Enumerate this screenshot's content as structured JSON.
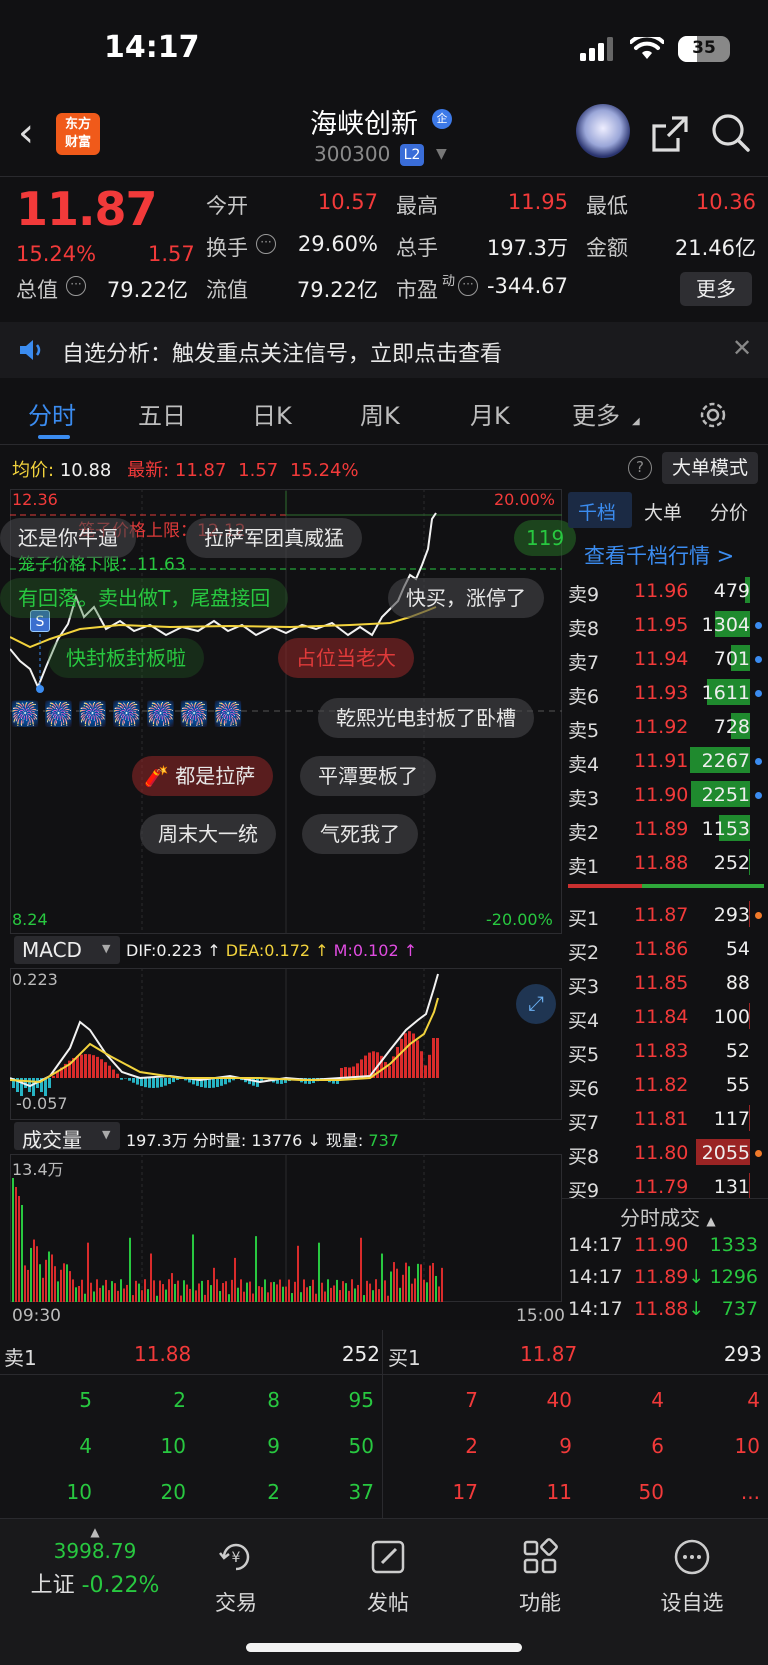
{
  "status": {
    "time": "14:17",
    "battery": "35"
  },
  "header": {
    "logo_line1": "东方",
    "logo_line2": "财富",
    "stock_name": "海峡创新",
    "stock_badge": "企",
    "stock_code": "300300",
    "level_badge": "L2"
  },
  "quote": {
    "price": "11.87",
    "pct": "15.24%",
    "change": "1.57",
    "open_label": "今开",
    "open": "10.57",
    "high_label": "最高",
    "high": "11.95",
    "low_label": "最低",
    "low": "10.36",
    "turnover_label": "换手",
    "turnover": "29.60%",
    "volume_label": "总手",
    "volume": "197.3万",
    "amount_label": "金额",
    "amount": "21.46亿",
    "mktcap_label": "总值",
    "mktcap": "79.22亿",
    "float_label": "流值",
    "float": "79.22亿",
    "pe_label": "市盈",
    "pe_sup": "动",
    "pe": "-344.67",
    "more_button": "更多"
  },
  "notice": {
    "text": "自选分析：触发重点关注信号，立即点击查看"
  },
  "tabs": [
    "分时",
    "五日",
    "日K",
    "周K",
    "月K",
    "更多"
  ],
  "chart_header": {
    "avg_label": "均价:",
    "avg_value": "10.88",
    "latest_label": "最新:",
    "latest_value": "11.87",
    "latest_change": "1.57",
    "latest_pct": "15.24%",
    "big_order_button": "大单模式"
  },
  "chart_labels": {
    "top_price": "12.36",
    "top_pct": "20.00%",
    "bottom_price": "8.24",
    "bottom_pct": "-20.00%",
    "cage_upper": "笼子价格上限：12.12",
    "cage_lower": "笼子价格下限：11.63",
    "sell_marker": "S",
    "right_edge_value": "119",
    "time_start": "09:30",
    "time_end": "15:00"
  },
  "bubbles": [
    "还是你牛逼",
    "拉萨军团真威猛",
    "有回落。卖出做T，尾盘接回",
    "快买，涨停了",
    "快封板封板啦",
    "占位当老大",
    "乾熙光电封板了卧槽",
    "都是拉萨",
    "平潭要板了",
    "周末大一统",
    "气死我了"
  ],
  "macd": {
    "label": "MACD",
    "dif": "DIF:0.223",
    "dea": "DEA:0.172",
    "m": "M:0.102",
    "top": "0.223",
    "bottom": "-0.057"
  },
  "volume_panel": {
    "label": "成交量",
    "total": "197.3万",
    "minute_label": "分时量:",
    "minute": "13776",
    "current_label": "现量:",
    "current": "737",
    "max": "13.4万"
  },
  "orderbook": {
    "tabs": [
      "千档",
      "大单",
      "分价"
    ],
    "view_depth": "查看千档行情 >",
    "asks": [
      {
        "label": "卖9",
        "price": "11.96",
        "vol": "479",
        "bar": 0.09,
        "dot": ""
      },
      {
        "label": "卖8",
        "price": "11.95",
        "vol": "1304",
        "bar": 0.58,
        "dot": "#3b8cf0"
      },
      {
        "label": "卖7",
        "price": "11.94",
        "vol": "701",
        "bar": 0.31,
        "dot": "#3b8cf0"
      },
      {
        "label": "卖6",
        "price": "11.93",
        "vol": "1611",
        "bar": 0.72,
        "dot": "#3b8cf0"
      },
      {
        "label": "卖5",
        "price": "11.92",
        "vol": "728",
        "bar": 0.32,
        "dot": ""
      },
      {
        "label": "卖4",
        "price": "11.91",
        "vol": "2267",
        "bar": 1.0,
        "dot": "#3b8cf0"
      },
      {
        "label": "卖3",
        "price": "11.90",
        "vol": "2251",
        "bar": 0.99,
        "dot": "#3b8cf0"
      },
      {
        "label": "卖2",
        "price": "11.89",
        "vol": "1153",
        "bar": 0.51,
        "dot": ""
      },
      {
        "label": "卖1",
        "price": "11.88",
        "vol": "252",
        "bar": 0.02,
        "dot": ""
      }
    ],
    "bids": [
      {
        "label": "买1",
        "price": "11.87",
        "vol": "293",
        "bar": 0.02,
        "dot": "#f07a2a"
      },
      {
        "label": "买2",
        "price": "11.86",
        "vol": "54",
        "bar": 0.0,
        "dot": ""
      },
      {
        "label": "买3",
        "price": "11.85",
        "vol": "88",
        "bar": 0.0,
        "dot": ""
      },
      {
        "label": "买4",
        "price": "11.84",
        "vol": "100",
        "bar": 0.02,
        "dot": ""
      },
      {
        "label": "买5",
        "price": "11.83",
        "vol": "52",
        "bar": 0.0,
        "dot": ""
      },
      {
        "label": "买6",
        "price": "11.82",
        "vol": "55",
        "bar": 0.0,
        "dot": ""
      },
      {
        "label": "买7",
        "price": "11.81",
        "vol": "117",
        "bar": 0.02,
        "dot": ""
      },
      {
        "label": "买8",
        "price": "11.80",
        "vol": "2055",
        "bar": 0.9,
        "dot": "#f07a2a"
      },
      {
        "label": "买9",
        "price": "11.79",
        "vol": "131",
        "bar": 0.02,
        "dot": ""
      }
    ],
    "ticks_title": "分时成交",
    "ticks": [
      {
        "time": "14:17",
        "price": "11.90",
        "arrow": "",
        "vol": "1333",
        "price_color": "#f23a3a"
      },
      {
        "time": "14:17",
        "price": "11.89",
        "arrow": "↓",
        "vol": "1296",
        "price_color": "#f23a3a"
      },
      {
        "time": "14:17",
        "price": "11.88",
        "arrow": "↓",
        "vol": "737",
        "price_color": "#f23a3a"
      }
    ]
  },
  "bottom_queue": {
    "sell_label": "卖1",
    "sell_price": "11.88",
    "sell_vol": "252",
    "buy_label": "买1",
    "buy_price": "11.87",
    "buy_vol": "293",
    "sell_rows": [
      [
        "5",
        "2",
        "8",
        "95"
      ],
      [
        "4",
        "10",
        "9",
        "50"
      ],
      [
        "10",
        "20",
        "2",
        "37"
      ]
    ],
    "buy_rows": [
      [
        "7",
        "40",
        "4",
        "4"
      ],
      [
        "2",
        "9",
        "6",
        "10"
      ],
      [
        "17",
        "11",
        "50",
        "..."
      ]
    ]
  },
  "bottom_nav": {
    "index_value": "3998.79",
    "index_name": "上证",
    "index_change": "-0.22%",
    "items": [
      "交易",
      "发帖",
      "功能",
      "设自选"
    ]
  },
  "colors": {
    "up": "#f23a3a",
    "down": "#28c840",
    "accent": "#3b8cf0",
    "avg_line": "#f2d33d"
  }
}
